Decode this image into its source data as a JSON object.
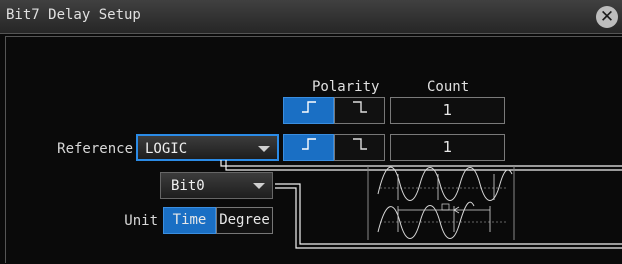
{
  "window": {
    "title": "Bit7 Delay Setup"
  },
  "headers": {
    "polarity": "Polarity",
    "count": "Count"
  },
  "row1": {
    "rise_icon": "╱̅",
    "fall_icon": "╲̲",
    "count": "1"
  },
  "row2": {
    "reference_label": "Reference",
    "reference_value": "LOGIC",
    "count": "1"
  },
  "bit_select": {
    "value": "Bit0"
  },
  "unit": {
    "label": "Unit",
    "options": [
      "Time",
      "Degree"
    ],
    "selected": "Time"
  },
  "colors": {
    "accent": "#1a6fc4",
    "focus": "#2b8be6"
  }
}
